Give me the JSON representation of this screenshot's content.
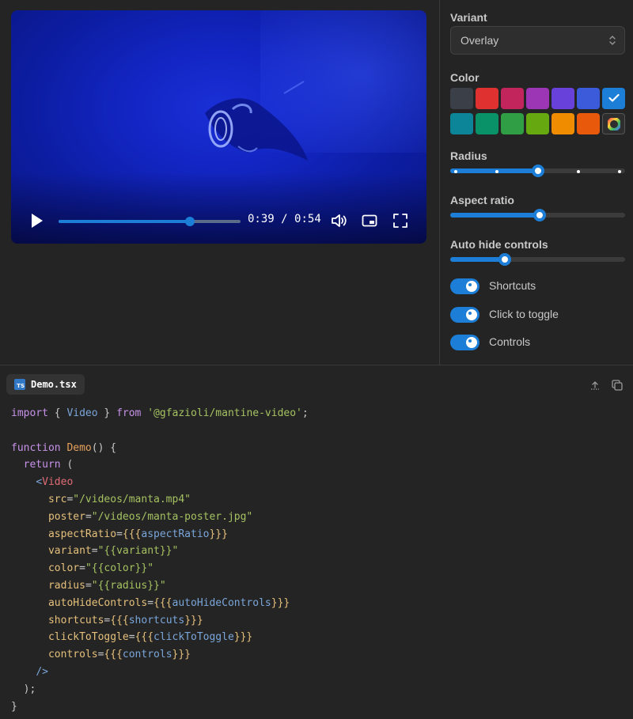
{
  "video": {
    "current_time": "0:39",
    "separator": "/",
    "duration": "0:54",
    "progress": 0.72
  },
  "panel": {
    "variant": {
      "label": "Variant",
      "value": "Overlay"
    },
    "color": {
      "label": "Color",
      "swatches": [
        "#3b3f48",
        "#e03131",
        "#c2255c",
        "#9c36b5",
        "#6741d9",
        "#3b5bdb",
        "#1c7ed6",
        "#0c8599",
        "#099268",
        "#2f9e44",
        "#66a80f",
        "#f08c00",
        "#e8590c",
        "picker"
      ],
      "selected_index": 6
    },
    "radius": {
      "label": "Radius",
      "value_fraction": 0.5,
      "marks": 5
    },
    "aspect_ratio": {
      "label": "Aspect ratio",
      "value_fraction": 0.51
    },
    "auto_hide": {
      "label": "Auto hide controls",
      "value_fraction": 0.31
    },
    "switches": [
      {
        "label": "Shortcuts",
        "checked": true
      },
      {
        "label": "Click to toggle",
        "checked": true
      },
      {
        "label": "Controls",
        "checked": true
      }
    ]
  },
  "code": {
    "filename": "Demo.tsx",
    "ts_badge": "TS",
    "lines": {
      "import_kw": "import",
      "import_name": "Video",
      "from_kw": "from",
      "import_path": "'@gfazioli/mantine-video'",
      "function_kw": "function",
      "function_name": "Demo",
      "return_kw": "return",
      "tag_name": "Video",
      "src_attr": "src",
      "src_val": "\"/videos/manta.mp4\"",
      "poster_attr": "poster",
      "poster_val": "\"/videos/manta-poster.jpg\"",
      "aspect_attr": "aspectRatio",
      "aspect_var": "aspectRatio",
      "variant_attr": "variant",
      "variant_val": "\"{{variant}}\"",
      "color_attr": "color",
      "color_val": "\"{{color}}\"",
      "radius_attr": "radius",
      "radius_val": "\"{{radius}}\"",
      "autohide_attr": "autoHideControls",
      "autohide_var": "autoHideControls",
      "shortcuts_attr": "shortcuts",
      "shortcuts_var": "shortcuts",
      "clicktoggle_attr": "clickToToggle",
      "clicktoggle_var": "clickToToggle",
      "controls_attr": "controls",
      "controls_var": "controls"
    }
  }
}
